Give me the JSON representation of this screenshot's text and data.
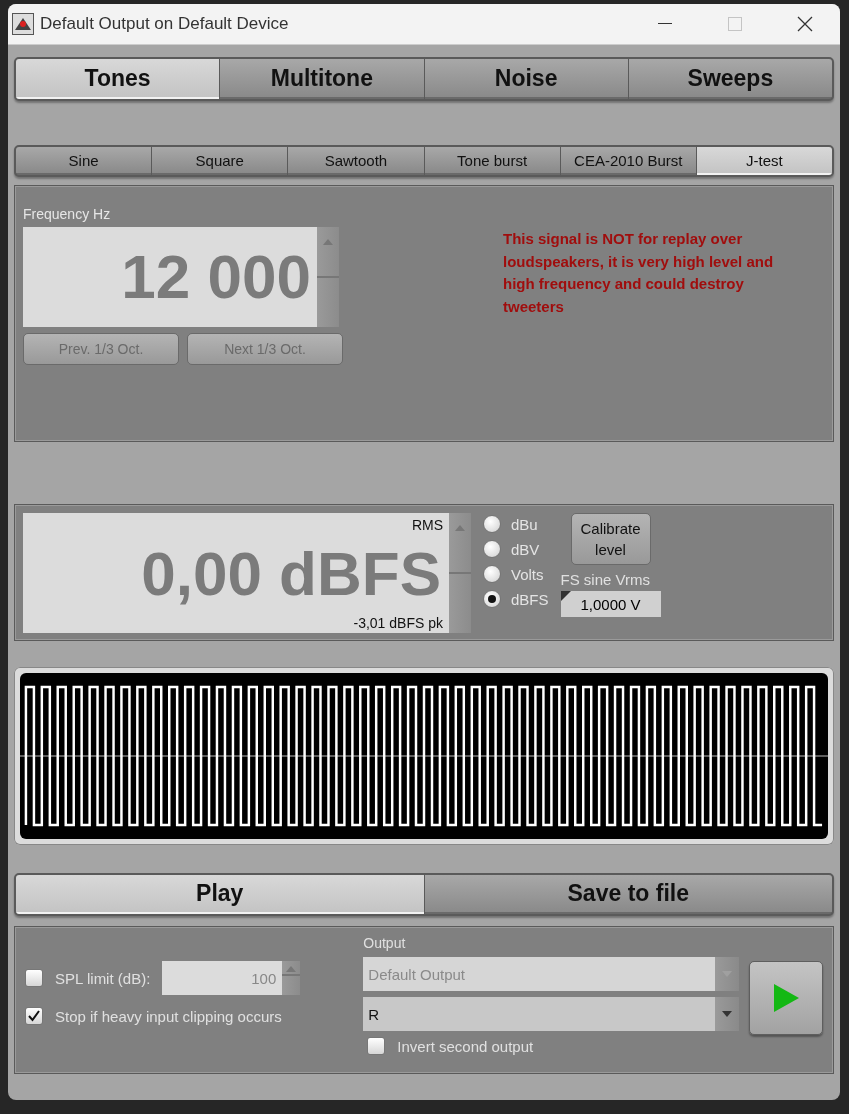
{
  "window": {
    "title": "Default Output on Default Device"
  },
  "main_tabs": [
    {
      "label": "Tones",
      "selected": true
    },
    {
      "label": "Multitone",
      "selected": false
    },
    {
      "label": "Noise",
      "selected": false
    },
    {
      "label": "Sweeps",
      "selected": false
    }
  ],
  "sub_tabs": [
    {
      "label": "Sine",
      "selected": false
    },
    {
      "label": "Square",
      "selected": false
    },
    {
      "label": "Sawtooth",
      "selected": false
    },
    {
      "label": "Tone burst",
      "selected": false
    },
    {
      "label": "CEA-2010 Burst",
      "selected": false
    },
    {
      "label": "J-test",
      "selected": true
    }
  ],
  "frequency": {
    "label": "Frequency Hz",
    "value": "12 000",
    "buttons": [
      {
        "label": "Prev. 1/3 Oct.",
        "disabled": true
      },
      {
        "label": "Next 1/3 Oct.",
        "disabled": true
      }
    ]
  },
  "warning": "This signal is NOT for replay over loudspeakers, it is very high level and high frequency and could destroy tweeters",
  "level": {
    "mode": "RMS",
    "value": "0,00 dBFS",
    "peak": "-3,01 dBFS pk",
    "units": [
      {
        "label": "dBu",
        "selected": false
      },
      {
        "label": "dBV",
        "selected": false
      },
      {
        "label": "Volts",
        "selected": false
      },
      {
        "label": "dBFS",
        "selected": true
      }
    ],
    "calibrate_button": "Calibrate level",
    "fs_label": "FS sine Vrms",
    "fs_value": "1,0000 V"
  },
  "action_tabs": [
    {
      "label": "Play",
      "selected": true
    },
    {
      "label": "Save to file",
      "selected": false
    }
  ],
  "options": {
    "spl_limit": {
      "label": "SPL limit (dB):",
      "checked": false,
      "value": "100"
    },
    "stop_clipping": {
      "label": "Stop if heavy input clipping occurs",
      "checked": true
    },
    "output_label": "Output",
    "device": {
      "value": "Default Output",
      "disabled": true
    },
    "channel": {
      "value": "R",
      "disabled": false
    },
    "invert": {
      "label": "Invert second output",
      "checked": false
    }
  }
}
